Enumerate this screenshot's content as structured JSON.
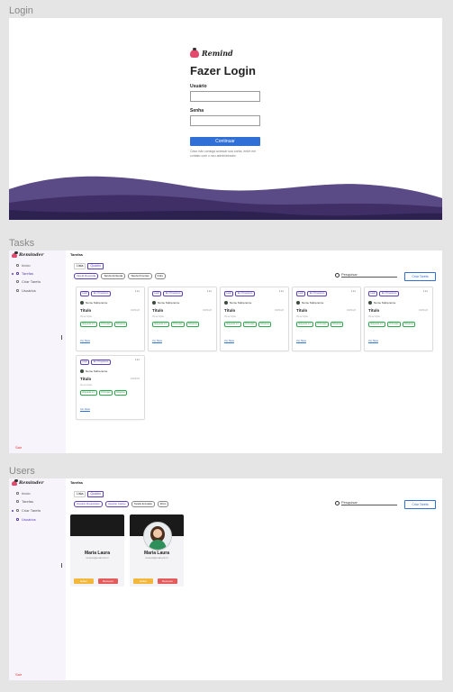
{
  "frames": {
    "login": "Login",
    "tasks": "Tasks",
    "users": "Users"
  },
  "login": {
    "logo": "Remind",
    "title": "Fazer Login",
    "user_label": "Usuário",
    "pass_label": "Senha",
    "button": "Continuar",
    "note": "Caso não consiga acessar sua conta, entre em contato com o seu administrador."
  },
  "app": {
    "logo": "Reminder",
    "nav": [
      "Início",
      "Tarefas",
      "Criar Tarefa",
      "Usuários"
    ],
    "exit": "Sair",
    "page_title": "Tarefas",
    "view": [
      "Lista",
      "Quadro"
    ],
    "search_placeholder": "Pesquisar",
    "create_button": "Criar Tarefa",
    "colors": {
      "accent": "#5b3fb8",
      "blue": "#2f6fd6",
      "wave": "#3f2f66",
      "tag": "#2aa84a"
    }
  },
  "tasks": {
    "filters": [
      "Tarefa Repetida",
      "Tarefa Atribuída",
      "Tarefa Próprias",
      "Filtro"
    ],
    "card": {
      "status_chips": [
        "Hoje",
        "Em Progresso"
      ],
      "owner": "Nome Sobrenome",
      "title": "Título",
      "date": "01/01/24",
      "description": "Descrição",
      "tags": [
        "Etiqueta um",
        "Principal",
        "Etiqueta"
      ],
      "more": "Ver Mais"
    }
  },
  "users": {
    "filters": [
      "Usuário Registrado",
      "Usuário Inativo",
      "Tarefa Enviada",
      "Filtro"
    ],
    "people": [
      {
        "name": "Maria Laura",
        "email": "ma.laura@email.com.br",
        "edit": "Editar",
        "delete": "Remover"
      },
      {
        "name": "Maria Laura",
        "email": "ma.laura@email.com.br",
        "edit": "Editar",
        "delete": "Remover"
      }
    ]
  }
}
